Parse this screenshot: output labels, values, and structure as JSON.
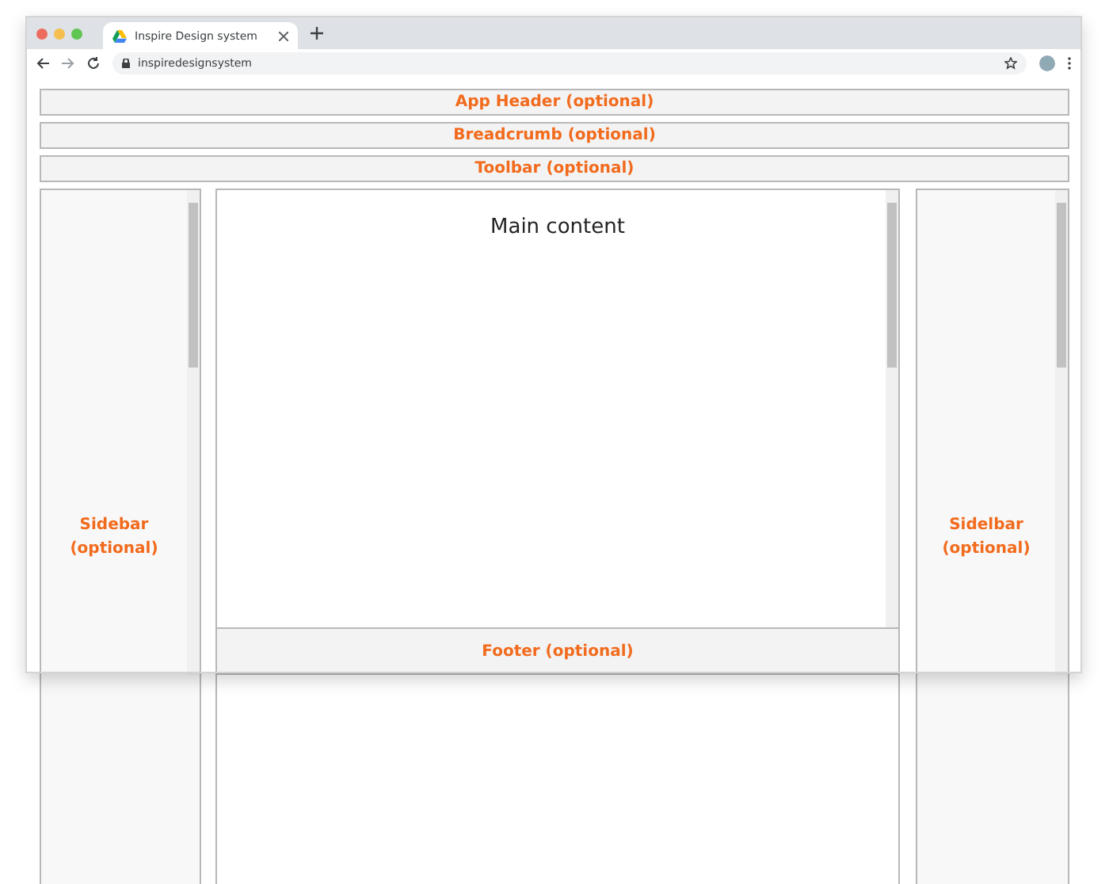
{
  "browser": {
    "tab_title": "Inspire Design system",
    "url": "inspiredesignsystem"
  },
  "layout": {
    "app_header": "App Header (optional)",
    "breadcrumb": "Breadcrumb (optional)",
    "toolbar": "Toolbar (optional)",
    "left_sidebar": "Sidebar (optional)",
    "main_title": "Main content",
    "footer": "Footer (optional)",
    "right_sidebar": "Sidelbar (optional)"
  }
}
